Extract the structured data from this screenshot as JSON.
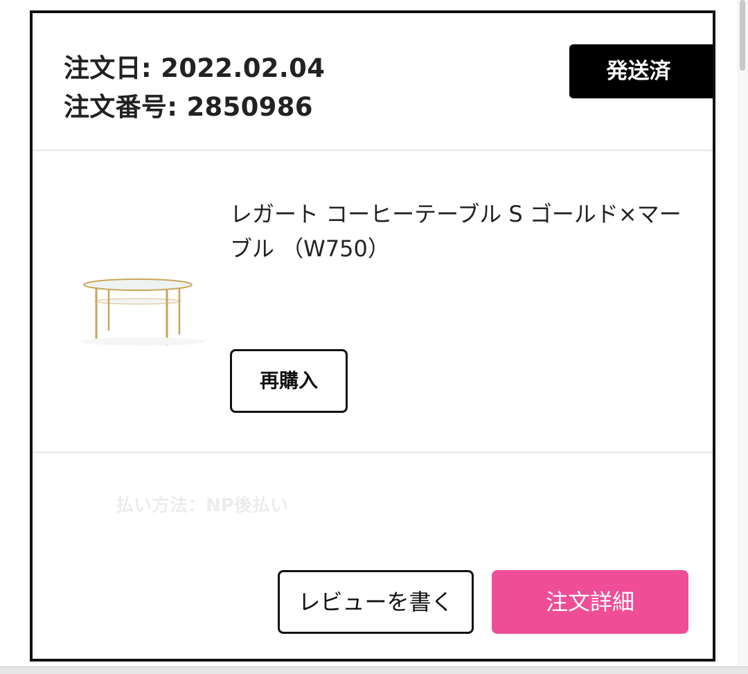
{
  "order": {
    "date_line": "注文日: 2022.02.04",
    "number_line": "注文番号: 2850986",
    "status": "発送済"
  },
  "item": {
    "name": "レガート コーヒーテーブル S ゴールド×マーブル （W750）",
    "faded_text": "",
    "rebuy_label": "再購入"
  },
  "payment": {
    "faded_line1": "",
    "faded_line2": "払い方法：NP後払い"
  },
  "actions": {
    "review_label": "レビューを書く",
    "detail_label": "注文詳細"
  },
  "colors": {
    "accent": "#ef4e97",
    "badge_bg": "#000000",
    "border": "#111111"
  }
}
